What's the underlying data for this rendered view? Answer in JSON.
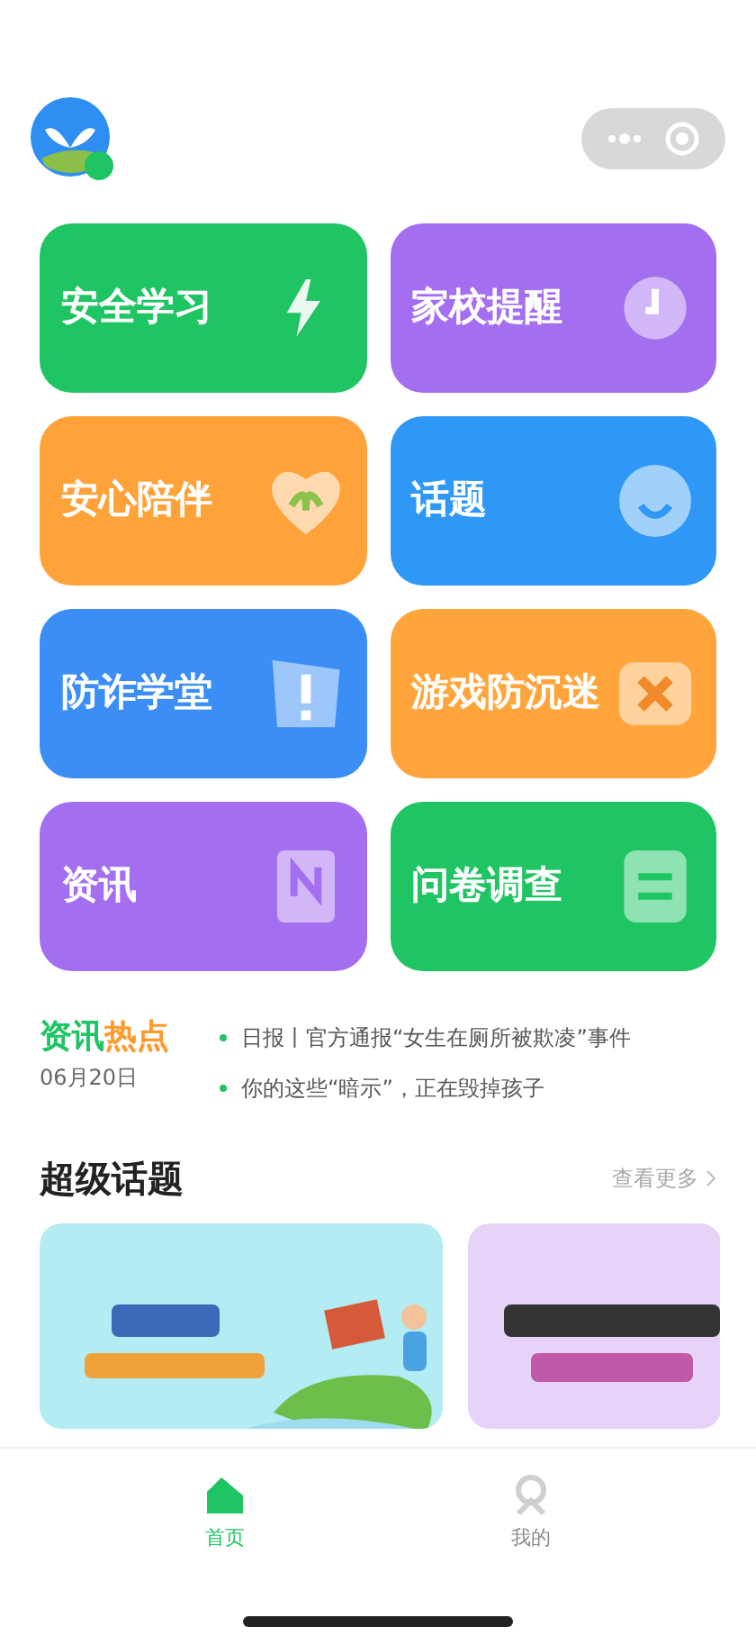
{
  "tiles": [
    {
      "label": "安全学习",
      "color": "#1fc463"
    },
    {
      "label": "家校提醒",
      "color": "#a46ef0"
    },
    {
      "label": "安心陪伴",
      "color": "#ffa23a"
    },
    {
      "label": "话题",
      "color": "#2f98f7"
    },
    {
      "label": "防诈学堂",
      "color": "#3a8ef6"
    },
    {
      "label": "游戏防沉迷",
      "color": "#ffa53c"
    },
    {
      "label": "资讯",
      "color": "#a46ef0"
    },
    {
      "label": "问卷调查",
      "color": "#1fc463"
    }
  ],
  "news": {
    "title_a": "资讯",
    "title_b": "热点",
    "date": "06月20日",
    "items": [
      "日报丨官方通报“女生在厕所被欺凌”事件",
      "你的这些“暗示”，正在毁掉孩子"
    ]
  },
  "section": {
    "title": "超级话题",
    "more": "查看更多"
  },
  "tabbar": [
    {
      "label": "首页",
      "selected": true
    },
    {
      "label": "我的",
      "selected": false
    }
  ]
}
